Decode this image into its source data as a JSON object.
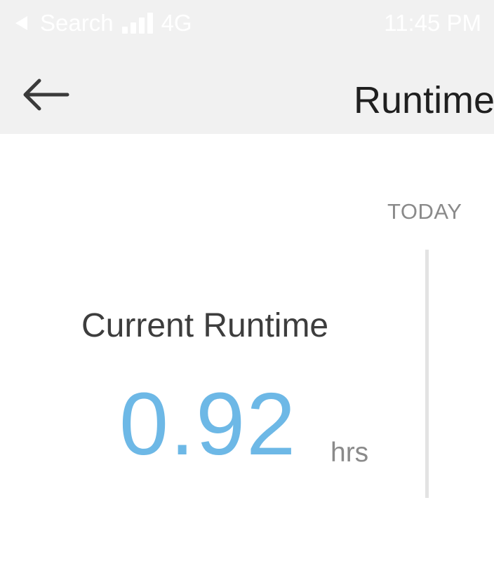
{
  "status_bar": {
    "back_label": "Search",
    "network": "4G",
    "time": "11:45 PM"
  },
  "nav": {
    "title": "Runtime",
    "back_icon": "arrow-left-icon"
  },
  "period": {
    "label": "TODAY"
  },
  "runtime": {
    "label": "Current Runtime",
    "value": "0.92",
    "unit": "hrs",
    "accent_color": "#6db8e6"
  }
}
